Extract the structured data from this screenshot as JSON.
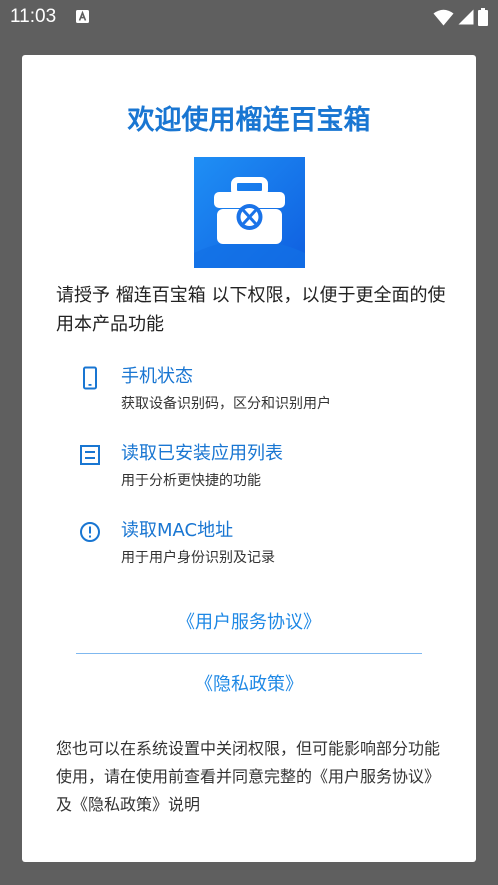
{
  "status_bar": {
    "time": "11:03",
    "icons": [
      "notification-a-icon",
      "wifi-icon",
      "cell-signal-icon",
      "battery-icon"
    ]
  },
  "dialog": {
    "title": "欢迎使用榴连百宝箱",
    "logo_icon": "toolbox-icon",
    "intro": "请授予 榴连百宝箱 以下权限，以便于更全面的使用本产品功能",
    "permissions": [
      {
        "icon": "phone-icon",
        "title": "手机状态",
        "desc": "获取设备识别码，区分和识别用户"
      },
      {
        "icon": "list-icon",
        "title": "读取已安装应用列表",
        "desc": "用于分析更快捷的功能"
      },
      {
        "icon": "info-icon",
        "title": "读取MAC地址",
        "desc": "用于用户身份识别及记录"
      }
    ],
    "links": {
      "user_agreement": "《用户服务协议》",
      "privacy_policy": "《隐私政策》"
    },
    "footer": "您也可以在系统设置中关闭权限，但可能影响部分功能使用，请在使用前查看并同意完整的《用户服务协议》及《隐私政策》说明"
  },
  "colors": {
    "accent": "#1976d2",
    "link": "#1e88e5",
    "scrim": "#5f5f5f"
  }
}
